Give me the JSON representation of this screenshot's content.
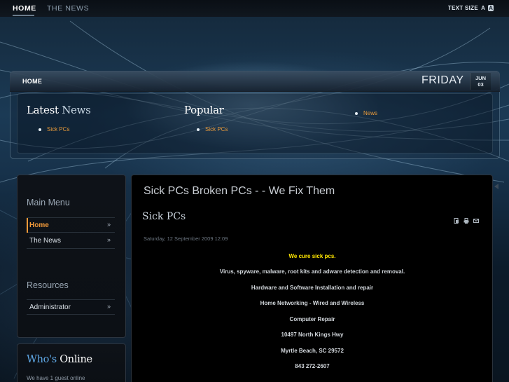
{
  "topnav": {
    "items": [
      {
        "label": "HOME",
        "active": true
      },
      {
        "label": "THE NEWS",
        "active": false
      }
    ],
    "text_size_label": "TEXT SIZE",
    "text_size_small": "A",
    "text_size_large": "A"
  },
  "header": {
    "breadcrumb": "HOME",
    "day": "FRIDAY",
    "month": "JUN",
    "date": "03"
  },
  "modules": {
    "latest": {
      "title_a": "Latest",
      "title_b": "News",
      "items": [
        "Sick PCs"
      ]
    },
    "popular": {
      "title": "Popular",
      "items": [
        "Sick PCs"
      ]
    },
    "third": {
      "items": [
        "News"
      ]
    }
  },
  "sidebar": {
    "main_menu_heading": "Main Menu",
    "main_menu": [
      {
        "label": "Home",
        "arrow": "»",
        "active": true
      },
      {
        "label": "The News",
        "arrow": "»",
        "active": false
      }
    ],
    "resources_heading": "Resources",
    "resources": [
      {
        "label": "Administrator",
        "arrow": "»"
      }
    ],
    "whos_online": {
      "title_a": "Who's",
      "title_b": "Online",
      "text": "We have 1 guest online"
    }
  },
  "main": {
    "site_title": "Sick PCs Broken PCs - - We Fix Them",
    "article": {
      "title": "Sick PCs",
      "date": "Saturday, 12 September 2009 12:09",
      "icons": [
        "pdf-icon",
        "print-icon",
        "email-icon"
      ],
      "lines": [
        "We cure sick pcs.",
        "Virus, spyware, malware, root kits and adware detection and removal.",
        "Hardware and Software Installation and repair",
        "Home Networking - Wired and Wireless",
        "Computer Repair",
        "10497 North Kings Hwy",
        "Myrtle Beach, SC 29572",
        "843 272-2607"
      ]
    }
  },
  "colors": {
    "accent_orange": "#f29a3a",
    "highlight_yellow": "#ffe600",
    "whos_blue": "#5fa8e6"
  }
}
